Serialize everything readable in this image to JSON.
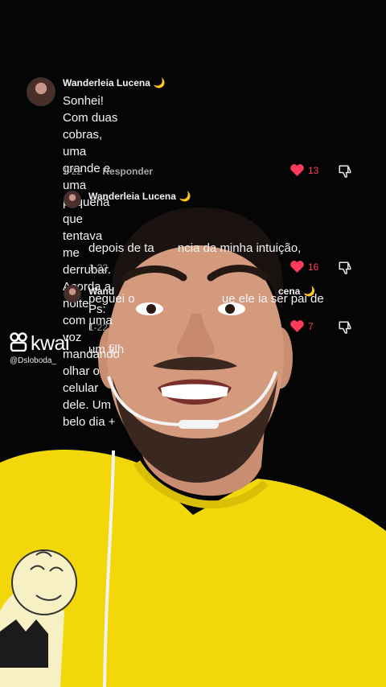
{
  "comments": [
    {
      "author": "Wanderleia Lucena",
      "badge": "🌙",
      "text_lines": [
        "Sonhei! Com duas cobras, uma grande e uma",
        "pequena que tentava me derrubar. Acorda a noite",
        "com uma voz mandando olhar o celular dele. Um",
        "belo dia +"
      ],
      "date": "1-22",
      "reply_label": "Responder",
      "likes": "13"
    },
    {
      "author": "Wanderleia Lucena",
      "badge": "🌙",
      "text_lines": [
        "depois de ta       ncia da minha intuição,",
        "peguei o                          ue ele ia ser pai de",
        "um filh"
      ],
      "date": "1-22",
      "likes": "16"
    },
    {
      "author": "Wand",
      "author_tail": "cena",
      "badge": "🌙",
      "text_lines": [
        "Ps: r"
      ],
      "date": "1-22",
      "likes": "7"
    }
  ],
  "watermark": {
    "brand": "kwai",
    "handle": "@Dsloboda_"
  },
  "colors": {
    "like": "#ff3b5c",
    "shirt": "#f2d80a",
    "background": "#000000"
  },
  "icons": [
    "heart-icon",
    "thumbs-down-icon",
    "kwai-logo-icon",
    "avatar"
  ]
}
